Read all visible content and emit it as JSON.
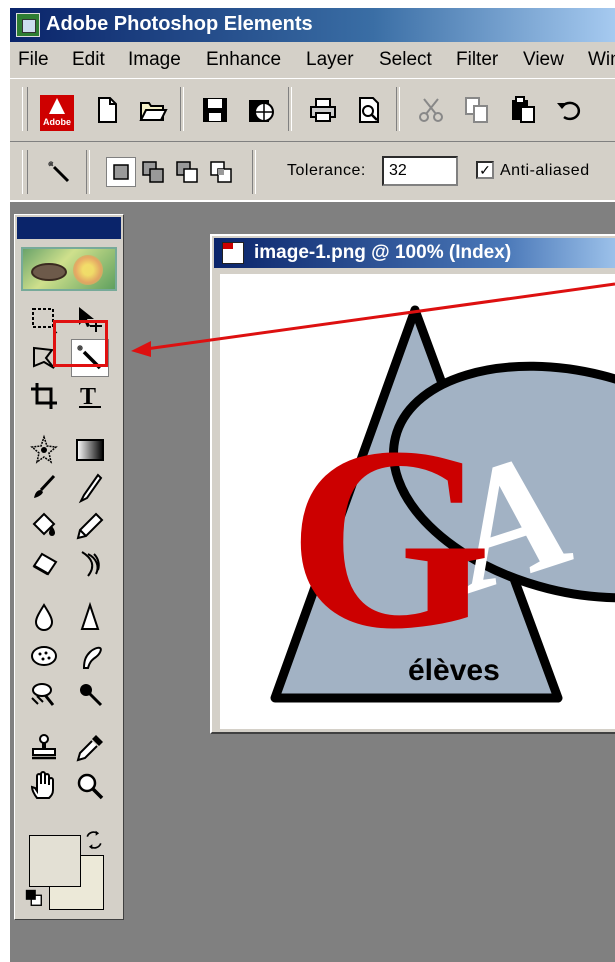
{
  "window": {
    "title": "Adobe Photoshop Elements",
    "icon": "photoshop-elements-app-icon"
  },
  "menubar": {
    "items": [
      "File",
      "Edit",
      "Image",
      "Enhance",
      "Layer",
      "Select",
      "Filter",
      "View",
      "Win"
    ]
  },
  "toolbar": {
    "adobe_logo_text": "Adobe",
    "buttons": [
      "new-document-icon",
      "open-folder-icon",
      "save-icon",
      "save-for-web-icon",
      "print-icon",
      "print-preview-icon",
      "cut-icon",
      "copy-icon",
      "paste-icon",
      "undo-icon"
    ]
  },
  "options_bar": {
    "tool_icon": "magic-wand-icon",
    "selection_modes": [
      "new-selection-icon",
      "add-to-selection-icon",
      "subtract-from-selection-icon",
      "intersect-selection-icon"
    ],
    "tolerance_label": "Tolerance:",
    "tolerance_value": "32",
    "anti_aliased_label": "Anti-aliased",
    "anti_aliased_checked": true
  },
  "toolbox": {
    "tools": [
      "marquee-icon",
      "move-icon",
      "lasso-icon",
      "magic-wand-icon",
      "crop-icon",
      "type-icon",
      "custom-shape-icon",
      "gradient-icon",
      "paintbrush-icon",
      "airbrush-icon",
      "paint-bucket-icon",
      "pencil-icon",
      "eraser-icon",
      "red-eye-brush-icon",
      "blur-icon",
      "sharpen-icon",
      "sponge-icon",
      "smudge-icon",
      "dodge-icon",
      "burn-icon",
      "clone-stamp-icon",
      "eyedropper-icon",
      "hand-icon",
      "zoom-icon"
    ],
    "selected_tool": "magic-wand-icon",
    "highlight_color": "#e01010"
  },
  "document": {
    "title": "image-1.png @ 100% (Index)",
    "logo": {
      "big_letter": "G",
      "small_letter": "A",
      "caption": "élèves",
      "red": "#cc0000",
      "steel_blue": "#a2b2c4"
    }
  },
  "colors": {
    "title_bar": "#0a246a",
    "chrome": "#d4d0c8",
    "workspace": "#808080"
  }
}
